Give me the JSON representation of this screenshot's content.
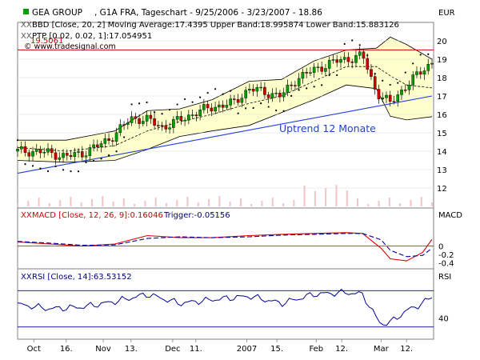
{
  "header": {
    "symbol": "GEA GROUP",
    "title_rest": ", G1A FRA, Tageschart - 9/25/2006 - 3/23/2007 - 18.86",
    "bbd": "BBD [Close, 20, 2] Moving Average:17.4395 Upper Band:18.995874 Lower Band:15.883126",
    "ptp": "PTP [0.02, 0.02, 1]:17.054951",
    "watermark": "© www.tradesignal.com",
    "ref_label": "19.5061",
    "currency": "EUR"
  },
  "annotation": {
    "uptrend": "Uptrend 12 Monate"
  },
  "macd_panel": {
    "label": "MACD [Close, 12, 26, 9]:0.16046",
    "trigger": "Trigger:-0.05156",
    "axis_title": "MACD"
  },
  "rsi_panel": {
    "label": "RSI [Close, 14]:63.53152",
    "axis_title": "RSI"
  },
  "colors": {
    "band_fill": "#ffffcc",
    "candle_up": "#00a000",
    "candle_down": "#d00000",
    "trend_line": "#1f3fd8",
    "ref_line": "#d00000",
    "macd_line": "#e00000",
    "trigger_line": "#0000a0",
    "rsi_line": "#0000a0",
    "panel_border": "#808080"
  },
  "chart_data": [
    {
      "type": "candlestick",
      "panel": "price",
      "ylim": [
        11,
        21
      ],
      "yticks": [
        12,
        13,
        14,
        15,
        16,
        17,
        18,
        19,
        20
      ],
      "x_range": [
        "2006-09-25",
        "2007-03-23"
      ],
      "xticks": [
        {
          "date": "2006-10-02",
          "label": "Oct"
        },
        {
          "date": "2006-10-16",
          "label": "16."
        },
        {
          "date": "2006-11-01",
          "label": "Nov"
        },
        {
          "date": "2006-11-13",
          "label": "13."
        },
        {
          "date": "2006-12-01",
          "label": "Dec"
        },
        {
          "date": "2006-12-11",
          "label": "11."
        },
        {
          "date": "2007-01-02",
          "label": "2007"
        },
        {
          "date": "2007-01-15",
          "label": "15."
        },
        {
          "date": "2007-02-01",
          "label": "Feb"
        },
        {
          "date": "2007-02-12",
          "label": "12."
        },
        {
          "date": "2007-03-01",
          "label": "Mar"
        },
        {
          "date": "2007-03-12",
          "label": "12."
        }
      ],
      "close": [
        [
          "2006-09-25",
          14.0
        ],
        [
          "2006-10-02",
          14.0
        ],
        [
          "2006-10-09",
          13.9
        ],
        [
          "2006-10-16",
          13.7
        ],
        [
          "2006-10-23",
          13.9
        ],
        [
          "2006-10-30",
          14.3
        ],
        [
          "2006-11-06",
          14.9
        ],
        [
          "2006-11-13",
          15.8
        ],
        [
          "2006-11-20",
          15.7
        ],
        [
          "2006-11-27",
          15.3
        ],
        [
          "2006-12-04",
          15.7
        ],
        [
          "2006-12-11",
          16.1
        ],
        [
          "2006-12-18",
          16.4
        ],
        [
          "2006-12-27",
          16.6
        ],
        [
          "2007-01-03",
          17.4
        ],
        [
          "2007-01-10",
          17.2
        ],
        [
          "2007-01-17",
          17.0
        ],
        [
          "2007-01-24",
          18.0
        ],
        [
          "2007-01-31",
          18.4
        ],
        [
          "2007-02-07",
          18.8
        ],
        [
          "2007-02-14",
          19.0
        ],
        [
          "2007-02-21",
          19.2
        ],
        [
          "2007-02-27",
          17.2
        ],
        [
          "2007-03-05",
          16.6
        ],
        [
          "2007-03-12",
          17.6
        ],
        [
          "2007-03-19",
          18.4
        ],
        [
          "2007-03-23",
          18.86
        ]
      ],
      "bollinger": [
        {
          "date": "2006-09-25",
          "upper": 14.6,
          "middle": 14.2,
          "lower": 13.5
        },
        {
          "date": "2006-10-16",
          "upper": 14.6,
          "middle": 14.0,
          "lower": 13.4
        },
        {
          "date": "2006-11-06",
          "upper": 15.1,
          "middle": 14.3,
          "lower": 13.5
        },
        {
          "date": "2006-11-20",
          "upper": 16.2,
          "middle": 15.1,
          "lower": 14.1
        },
        {
          "date": "2006-12-04",
          "upper": 16.3,
          "middle": 15.6,
          "lower": 14.8
        },
        {
          "date": "2006-12-18",
          "upper": 16.8,
          "middle": 16.0,
          "lower": 15.1
        },
        {
          "date": "2007-01-03",
          "upper": 17.8,
          "middle": 16.6,
          "lower": 15.4
        },
        {
          "date": "2007-01-17",
          "upper": 17.9,
          "middle": 17.0,
          "lower": 16.1
        },
        {
          "date": "2007-01-31",
          "upper": 18.9,
          "middle": 17.8,
          "lower": 16.8
        },
        {
          "date": "2007-02-14",
          "upper": 19.5,
          "middle": 18.6,
          "lower": 17.6
        },
        {
          "date": "2007-02-27",
          "upper": 19.6,
          "middle": 18.6,
          "lower": 17.4
        },
        {
          "date": "2007-03-05",
          "upper": 20.2,
          "middle": 18.1,
          "lower": 15.9
        },
        {
          "date": "2007-03-12",
          "upper": 19.8,
          "middle": 17.6,
          "lower": 15.7
        },
        {
          "date": "2007-03-23",
          "upper": 19.0,
          "middle": 17.44,
          "lower": 15.88
        }
      ],
      "reference_level": 19.5061,
      "trend_line": [
        [
          "2006-09-25",
          12.8
        ],
        [
          "2007-03-23",
          17.0
        ]
      ]
    },
    {
      "type": "line",
      "panel": "macd",
      "yticks": [
        0,
        -0.2,
        -0.4
      ],
      "ylim": [
        -0.5,
        0.6
      ],
      "series": [
        {
          "name": "MACD",
          "values": [
            [
              "2006-09-25",
              0.1
            ],
            [
              "2006-10-09",
              0.05
            ],
            [
              "2006-10-23",
              0.0
            ],
            [
              "2006-11-06",
              0.05
            ],
            [
              "2006-11-20",
              0.25
            ],
            [
              "2006-12-04",
              0.2
            ],
            [
              "2006-12-18",
              0.2
            ],
            [
              "2007-01-03",
              0.25
            ],
            [
              "2007-01-17",
              0.28
            ],
            [
              "2007-01-31",
              0.3
            ],
            [
              "2007-02-14",
              0.32
            ],
            [
              "2007-02-21",
              0.3
            ],
            [
              "2007-03-01",
              -0.05
            ],
            [
              "2007-03-05",
              -0.3
            ],
            [
              "2007-03-12",
              -0.35
            ],
            [
              "2007-03-19",
              -0.15
            ],
            [
              "2007-03-23",
              0.16
            ]
          ]
        },
        {
          "name": "Trigger",
          "values": [
            [
              "2006-09-25",
              0.11
            ],
            [
              "2006-10-09",
              0.07
            ],
            [
              "2006-10-23",
              0.02
            ],
            [
              "2006-11-06",
              0.03
            ],
            [
              "2006-11-20",
              0.18
            ],
            [
              "2006-12-04",
              0.22
            ],
            [
              "2006-12-18",
              0.2
            ],
            [
              "2007-01-03",
              0.22
            ],
            [
              "2007-01-17",
              0.26
            ],
            [
              "2007-01-31",
              0.28
            ],
            [
              "2007-02-14",
              0.3
            ],
            [
              "2007-02-21",
              0.3
            ],
            [
              "2007-03-01",
              0.15
            ],
            [
              "2007-03-05",
              -0.1
            ],
            [
              "2007-03-12",
              -0.25
            ],
            [
              "2007-03-19",
              -0.22
            ],
            [
              "2007-03-23",
              -0.05
            ]
          ]
        }
      ]
    },
    {
      "type": "line",
      "panel": "rsi",
      "yticks": [
        40
      ],
      "ylim": [
        20,
        80
      ],
      "levels": [
        30,
        70
      ],
      "series": [
        {
          "name": "RSI",
          "values": [
            [
              "2006-09-25",
              55
            ],
            [
              "2006-10-09",
              50
            ],
            [
              "2006-10-23",
              52
            ],
            [
              "2006-11-06",
              58
            ],
            [
              "2006-11-20",
              66
            ],
            [
              "2006-12-04",
              56
            ],
            [
              "2006-12-18",
              60
            ],
            [
              "2007-01-03",
              64
            ],
            [
              "2007-01-17",
              56
            ],
            [
              "2007-01-31",
              66
            ],
            [
              "2007-02-14",
              68
            ],
            [
              "2007-02-21",
              66
            ],
            [
              "2007-02-27",
              40
            ],
            [
              "2007-03-01",
              33
            ],
            [
              "2007-03-05",
              35
            ],
            [
              "2007-03-12",
              48
            ],
            [
              "2007-03-19",
              56
            ],
            [
              "2007-03-23",
              63.5
            ]
          ]
        }
      ]
    }
  ]
}
